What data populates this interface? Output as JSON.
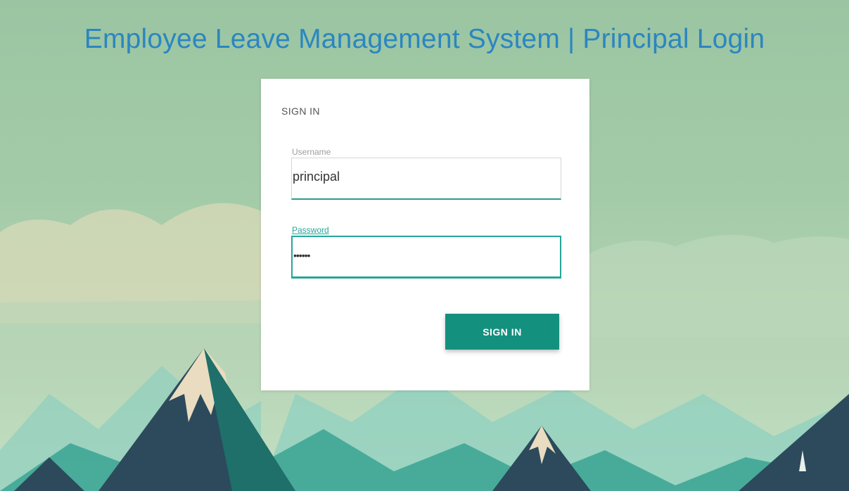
{
  "page": {
    "title": "Employee Leave Management System | Principal Login"
  },
  "card": {
    "heading": "SIGN IN",
    "username": {
      "label": "Username",
      "value": "principal"
    },
    "password": {
      "label": "Password",
      "value": "••••••"
    },
    "submit_label": "SIGN IN"
  },
  "colors": {
    "title": "#2b86c0",
    "accent": "#26a69a",
    "button": "#14907f",
    "background": "#9bc5a2"
  }
}
